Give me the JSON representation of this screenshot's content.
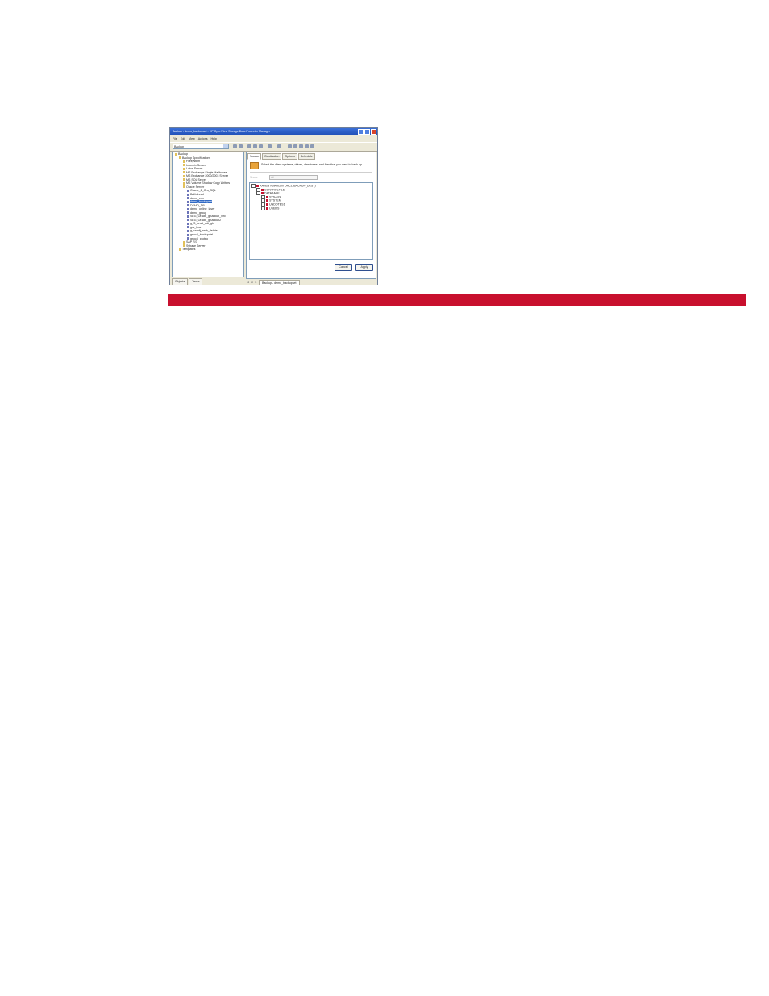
{
  "window": {
    "title": "Backup - demo_backupset - HP OpenView Storage Data Protector Manager"
  },
  "menu": [
    "File",
    "Edit",
    "View",
    "Actions",
    "Help"
  ],
  "context_select": "Backup",
  "left_tree": [
    {
      "label": "Backup",
      "depth": 0,
      "icon": "folder-icon"
    },
    {
      "label": "Backup Specifications",
      "depth": 1,
      "icon": "folder-icon"
    },
    {
      "label": "Filesystem",
      "depth": 2,
      "icon": "folder-icon"
    },
    {
      "label": "Informix Server",
      "depth": 2,
      "icon": "folder-icon"
    },
    {
      "label": "Lotus Server",
      "depth": 2,
      "icon": "folder-icon"
    },
    {
      "label": "MS Exchange Single Mailboxes",
      "depth": 2,
      "icon": "folder-icon"
    },
    {
      "label": "MS Exchange 2000/2003 Server",
      "depth": 2,
      "icon": "folder-icon"
    },
    {
      "label": "MS SQL Server",
      "depth": 2,
      "icon": "folder-icon"
    },
    {
      "label": "MS Volume Shadow Copy Writers",
      "depth": 2,
      "icon": "folder-icon"
    },
    {
      "label": "Oracle Server",
      "depth": 2,
      "icon": "folder-icon"
    },
    {
      "label": "Oracle_2_Ora_SQL",
      "depth": 3,
      "icon": "db-icon"
    },
    {
      "label": "BallinLead",
      "depth": 3,
      "icon": "db-icon"
    },
    {
      "label": "demo_crm",
      "depth": 3,
      "icon": "db-icon"
    },
    {
      "label": "demo_backupset",
      "depth": 3,
      "icon": "db-icon",
      "selected": true
    },
    {
      "label": "DEMO_DB",
      "depth": 3,
      "icon": "db-icon"
    },
    {
      "label": "demo_online_layer",
      "depth": 3,
      "icon": "db-icon"
    },
    {
      "label": "demo_group",
      "depth": 3,
      "icon": "db-icon"
    },
    {
      "label": "SEG_Oracle_gBackup_Orc",
      "depth": 3,
      "icon": "db-icon"
    },
    {
      "label": "SEG_Oracle_gBackup2",
      "depth": 3,
      "icon": "db-icon"
    },
    {
      "label": "g_S_oracl_cdt_gb",
      "depth": 3,
      "icon": "db-icon"
    },
    {
      "label": "gra_fma",
      "depth": 3,
      "icon": "db-icon"
    },
    {
      "label": "g_cronfj_arch_delete",
      "depth": 3,
      "icon": "db-icon"
    },
    {
      "label": "grloc8_backupdel",
      "depth": 3,
      "icon": "db-icon"
    },
    {
      "label": "grloc8_proteo",
      "depth": 3,
      "icon": "db-icon"
    },
    {
      "label": "SAP R/3",
      "depth": 2,
      "icon": "folder-icon"
    },
    {
      "label": "Sybase Server",
      "depth": 2,
      "icon": "folder-icon"
    },
    {
      "label": "Templates",
      "depth": 1,
      "icon": "folder-icon"
    }
  ],
  "left_tabs": [
    "Objects",
    "Tasks"
  ],
  "right_tabs": [
    "Source",
    "Destination",
    "Options",
    "Schedule"
  ],
  "instruction": "Select the client systems, drives, directories, and files that you want to back up.",
  "show_label": "Show:",
  "show_value": "All",
  "source_tree": [
    {
      "label": "RAVEN Novellcom ORCL(BACKUP_DEST)",
      "depth": 0,
      "type": "server"
    },
    {
      "label": "CONTROLFILE",
      "depth": 1,
      "type": "item"
    },
    {
      "label": "DATABASE",
      "depth": 1,
      "type": "item"
    },
    {
      "label": "SYSAUX",
      "depth": 2,
      "type": "ora"
    },
    {
      "label": "SYSTEM",
      "depth": 2,
      "type": "ora"
    },
    {
      "label": "UNDOTBS1",
      "depth": 2,
      "type": "ora"
    },
    {
      "label": "USERS",
      "depth": 2,
      "type": "ora"
    }
  ],
  "buttons": {
    "cancel": "Cancel",
    "apply": "Apply"
  },
  "bottom_tab": "Backup - demo_backupset",
  "colors": {
    "accent_red": "#c8102e",
    "window_bg": "#ece9d8",
    "title_blue": "#1f4fb5"
  }
}
